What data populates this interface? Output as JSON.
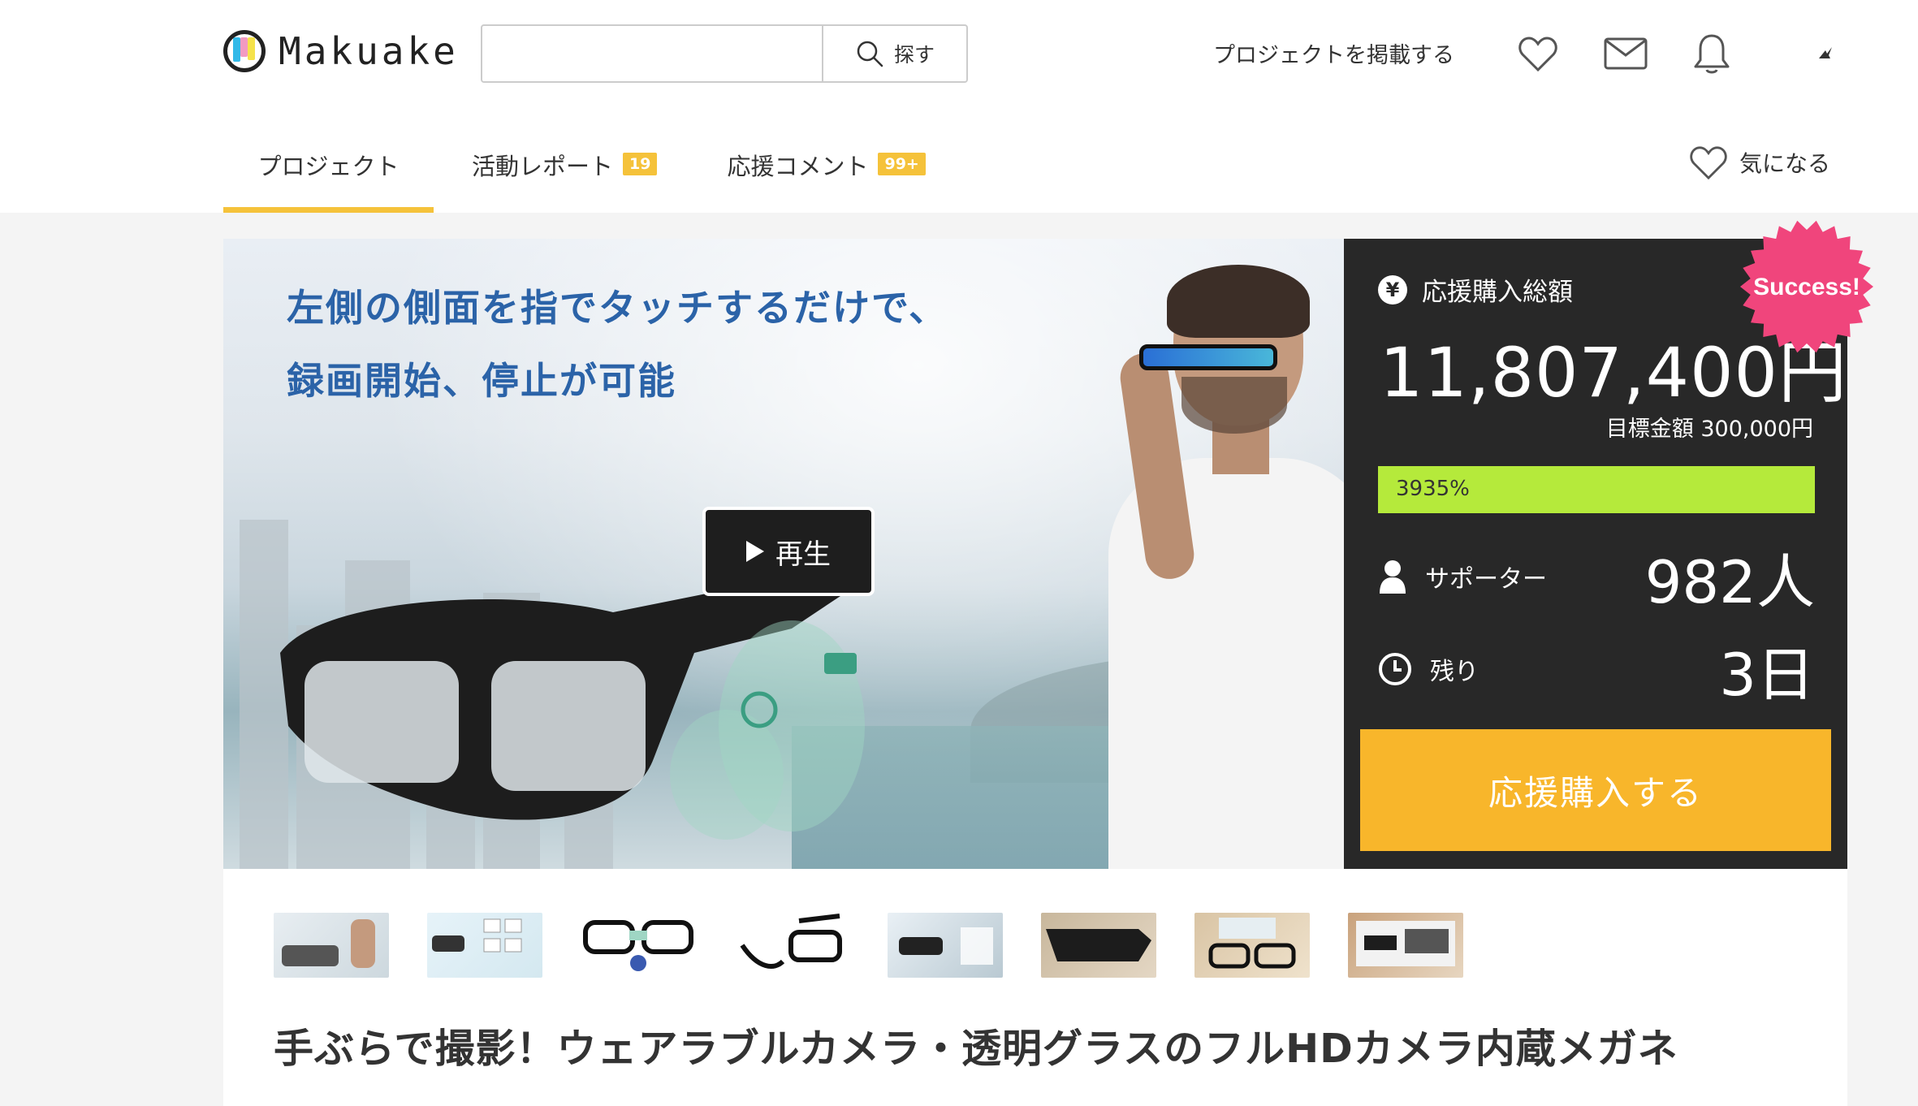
{
  "header": {
    "logo_text": "Makuake",
    "search": {
      "placeholder": "",
      "button_label": "探す"
    },
    "post_project_label": "プロジェクトを掲載する"
  },
  "tabs": [
    {
      "label": "プロジェクト",
      "badge": ""
    },
    {
      "label": "活動レポート",
      "badge": "19"
    },
    {
      "label": "応援コメント",
      "badge": "99+"
    }
  ],
  "favorite_label": "気になる",
  "hero": {
    "title_line1": "左側の側面を指でタッチするだけで、",
    "title_line2": "録画開始、停止が可能",
    "play_label": "再生"
  },
  "stats": {
    "total_label": "応援購入総額",
    "amount": "11,807,400円",
    "goal_text": "目標金額 300,000円",
    "percent_text": "3935%",
    "percent_value": 3935,
    "supporters_label": "サポーター",
    "supporters_value": "982人",
    "remaining_label": "残り",
    "remaining_value": "3日",
    "buy_label": "応援購入する",
    "badge": "Success!"
  },
  "project_title": "手ぶらで撮影！ウェアラブルカメラ・透明グラスのフルHDカメラ内蔵メガネ",
  "colors": {
    "accent": "#f5c23a",
    "panel_bg": "#282828",
    "progress": "#b5ea3b",
    "buy_button": "#f8b62b",
    "success_badge": "#f0457c"
  }
}
